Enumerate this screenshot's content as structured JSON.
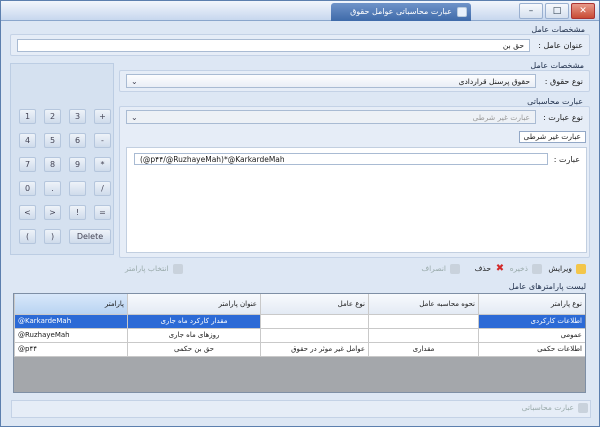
{
  "window": {
    "title": "عبارت محاسباتی عوامل حقوق"
  },
  "section1": {
    "title": "مشخصات عامل",
    "label": "عنوان عامل :",
    "value": "حق بن"
  },
  "section2": {
    "title": "مشخصات عامل",
    "label": "نوع حقوق :",
    "value": "حقوق پرسنل قراردادی"
  },
  "section3": {
    "title": "عبارت محاسباتی",
    "type_label": "نوع عبارت :",
    "type_value": "عبارت غیر شرطی",
    "tag": "عبارت غیر شرطی",
    "expr_label": "عبارت :",
    "expr_value": "(@p۴۴/@RuzhayeMah)*@KarkardeMah"
  },
  "keypad": {
    "rows": [
      [
        "1",
        "2",
        "3",
        "+"
      ],
      [
        "4",
        "5",
        "6",
        "-"
      ],
      [
        "7",
        "8",
        "9",
        "*"
      ],
      [
        "0",
        ".",
        "",
        "/"
      ],
      [
        "<",
        ">",
        "!",
        "="
      ],
      [
        "(",
        ")",
        "Delete"
      ]
    ]
  },
  "toolbar": {
    "edit": "ویرایش",
    "save": "ذخیره",
    "delete": "حذف",
    "cancel": "انصراف",
    "choose_param": "انتخاب پارامتر"
  },
  "params": {
    "title": "لیست پارامترهای عامل",
    "columns": [
      "پارامتر",
      "عنوان پارامتر",
      "نوع عامل",
      "نحوه محاسبه عامل",
      "نوع پارامتر"
    ],
    "rows": [
      [
        "@KarkardeMah",
        "مقدار کارکرد ماه جاری",
        "",
        "",
        "اطلاعات کارکردی"
      ],
      [
        "@RuzhayeMah",
        "روزهای ماه جاری",
        "",
        "",
        "عمومی"
      ],
      [
        "@p۴۴",
        "حق بن حکمی",
        "عوامل غیر موثر در حقوق",
        "مقداری",
        "اطلاعات حکمی"
      ]
    ],
    "selected_row": 0
  },
  "footer": {
    "label": "عبارت محاسباتی"
  },
  "colors": {
    "accent": "#2c6ad6",
    "window_bg": "#dde7f4",
    "delete_red": "#d22a2a",
    "grid_empty": "#a4a7ab"
  }
}
